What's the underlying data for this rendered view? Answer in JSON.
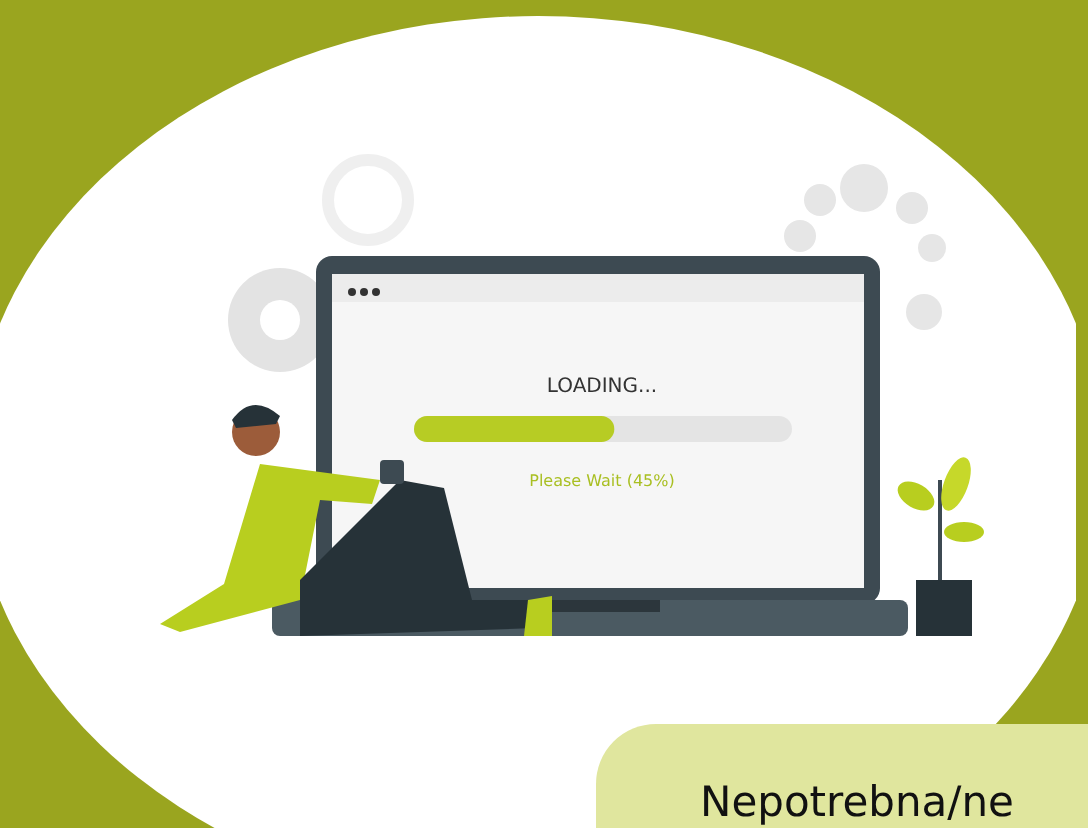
{
  "laptop_screen": {
    "title": "LOADING...",
    "progress": {
      "level": 0.53
    },
    "status": "Please Wait (45%)"
  },
  "card": {
    "text": "Nepotrebna/ne"
  }
}
